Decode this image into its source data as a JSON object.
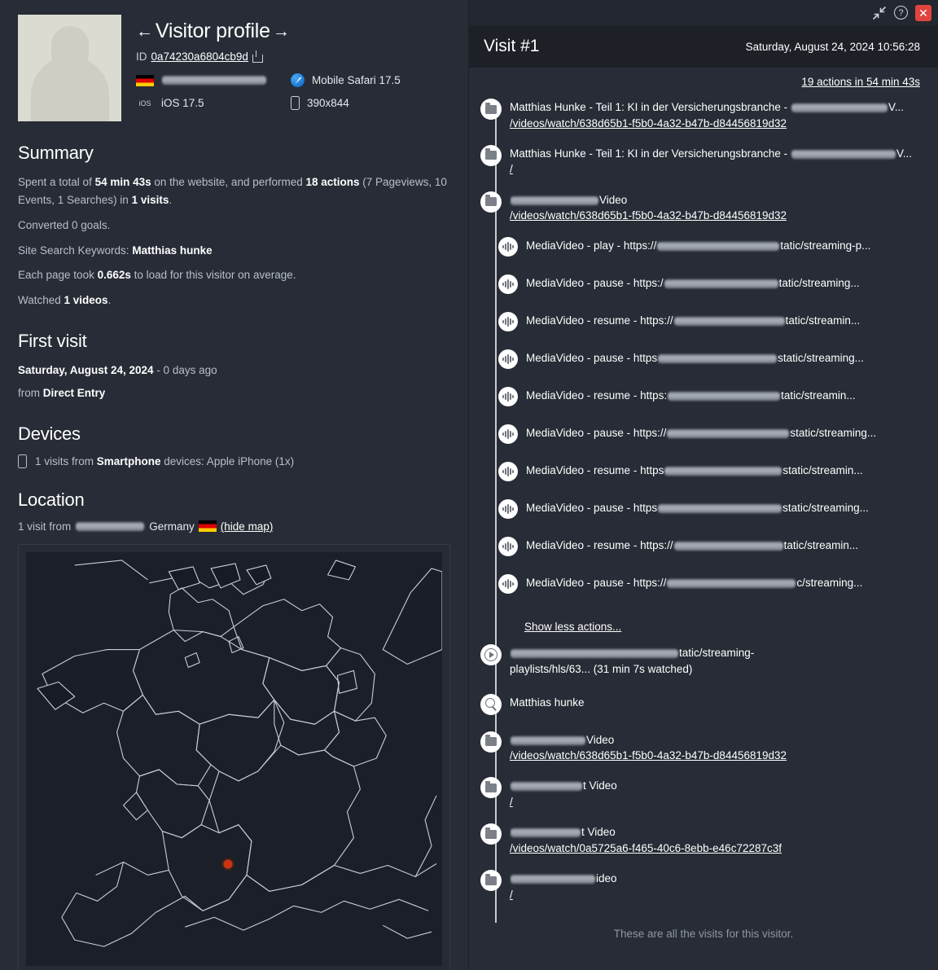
{
  "window": {
    "collapse_icon": "collapse-arrows-icon",
    "help_icon": "help-circle-icon",
    "help_glyph": "?",
    "close_icon": "close-icon",
    "close_glyph": "✕"
  },
  "profile": {
    "title": "Visitor profile",
    "prev_arrow": "←",
    "next_arrow": "→",
    "id_label": "ID",
    "id_value": "0a74230a6804cb9d",
    "share_icon": "share-icon",
    "country_redacted": true,
    "os_badge": "iOS",
    "os_label": "iOS 17.5",
    "browser_label": "Mobile Safari 17.5",
    "resolution_label": "390x844"
  },
  "summary": {
    "heading": "Summary",
    "line1_pre": "Spent a total of ",
    "line1_time": "54 min 43s",
    "line1_mid": " on the website, and performed ",
    "line1_actions": "18 actions",
    "line1_detail": " (7 Pageviews, 10 Events, 1 Searches) in ",
    "line1_visits": "1 visits",
    "line1_end": ".",
    "goals": "Converted 0 goals.",
    "search_label": "Site Search Keywords: ",
    "search_value": "Matthias hunke",
    "load_pre": "Each page took ",
    "load_time": "0.662s",
    "load_post": " to load for this visitor on average.",
    "watched_pre": "Watched ",
    "watched_value": "1 videos",
    "watched_post": "."
  },
  "first_visit": {
    "heading": "First visit",
    "date": "Saturday, August 24, 2024",
    "ago": " - 0 days ago",
    "from_label": "from ",
    "from_value": "Direct Entry"
  },
  "devices": {
    "heading": "Devices",
    "icon": "smartphone-icon",
    "text_pre": "1 visits from ",
    "device_type": "Smartphone",
    "text_post": " devices: Apple iPhone (1x)"
  },
  "location": {
    "heading": "Location",
    "text_pre": "1 visit from ",
    "city_redacted": true,
    "country": "Germany",
    "flag_icon": "germany-flag-icon",
    "hide_map_label": "(hide map)",
    "map_marker_color": "#cc3311"
  },
  "visit": {
    "title": "Visit #1",
    "datetime": "Saturday, August 24, 2024 10:56:28",
    "actions_summary": "19 actions in 54 min 43s",
    "show_less_label": "Show less actions...",
    "footer": "These are all the visits for this visitor.",
    "actions": [
      {
        "icon": "page-icon",
        "level": 0,
        "title": "Matthias Hunke - Teil 1: KI in der Versicherungsbranche - ",
        "title_suffix": "V...",
        "title_redacted": true,
        "url": "/videos/watch/638d65b1-f5b0-4a32-b47b-d84456819d32"
      },
      {
        "icon": "page-icon",
        "level": 0,
        "title": "Matthias Hunke - Teil 1: KI in der Versicherungsbranche - ",
        "title_suffix": "V...",
        "title_redacted": true,
        "url": "/"
      },
      {
        "icon": "page-icon",
        "level": 0,
        "title": "",
        "title_suffix": "Video",
        "title_redacted": true,
        "url": "/videos/watch/638d65b1-f5b0-4a32-b47b-d84456819d32"
      },
      {
        "icon": "media-icon",
        "level": 1,
        "title": "MediaVideo - play - https://",
        "title_suffix": "tatic/streaming-p...",
        "title_redacted": true,
        "url": ""
      },
      {
        "icon": "media-icon",
        "level": 1,
        "title": "MediaVideo - pause - https:/",
        "title_suffix": "tatic/streaming...",
        "title_redacted": true,
        "url": ""
      },
      {
        "icon": "media-icon",
        "level": 1,
        "title": "MediaVideo - resume - https://",
        "title_suffix": "tatic/streamin...",
        "title_redacted": true,
        "url": ""
      },
      {
        "icon": "media-icon",
        "level": 1,
        "title": "MediaVideo - pause - https",
        "title_suffix": "static/streaming...",
        "title_redacted": true,
        "url": ""
      },
      {
        "icon": "media-icon",
        "level": 1,
        "title": "MediaVideo - resume - https:",
        "title_suffix": "tatic/streamin...",
        "title_redacted": true,
        "url": ""
      },
      {
        "icon": "media-icon",
        "level": 1,
        "title": "MediaVideo - pause - https://",
        "title_suffix": "static/streaming...",
        "title_redacted": true,
        "url": ""
      },
      {
        "icon": "media-icon",
        "level": 1,
        "title": "MediaVideo - resume - https",
        "title_suffix": "static/streamin...",
        "title_redacted": true,
        "url": ""
      },
      {
        "icon": "media-icon",
        "level": 1,
        "title": "MediaVideo - pause - https",
        "title_suffix": "static/streaming...",
        "title_redacted": true,
        "url": ""
      },
      {
        "icon": "media-icon",
        "level": 1,
        "title": "MediaVideo - resume - https://",
        "title_suffix": "tatic/streamin...",
        "title_redacted": true,
        "url": ""
      },
      {
        "icon": "media-icon",
        "level": 1,
        "title": "MediaVideo - pause - https://",
        "title_suffix": "c/streaming...",
        "title_redacted": true,
        "url": ""
      },
      {
        "icon": "play-icon",
        "level": 0,
        "title": "",
        "title_suffix": "tatic/streaming-playlists/hls/63...",
        "title_redacted": true,
        "watched_note": "(31 min 7s watched)",
        "url": ""
      },
      {
        "icon": "search-icon",
        "level": 0,
        "title": "Matthias hunke",
        "title_suffix": "",
        "title_redacted": false,
        "url": ""
      },
      {
        "icon": "page-icon",
        "level": 0,
        "title": "",
        "title_suffix": "Video",
        "title_redacted": true,
        "url": "/videos/watch/638d65b1-f5b0-4a32-b47b-d84456819d32"
      },
      {
        "icon": "page-icon",
        "level": 0,
        "title": "",
        "title_suffix": "t Video",
        "title_redacted": true,
        "url": "/"
      },
      {
        "icon": "page-icon",
        "level": 0,
        "title": "",
        "title_suffix": "t Video",
        "title_redacted": true,
        "url": "/videos/watch/0a5725a6-f465-40c6-8ebb-e46c72287c3f"
      },
      {
        "icon": "page-icon",
        "level": 0,
        "title": "",
        "title_suffix": "ideo",
        "title_redacted": true,
        "url": "/"
      }
    ]
  }
}
